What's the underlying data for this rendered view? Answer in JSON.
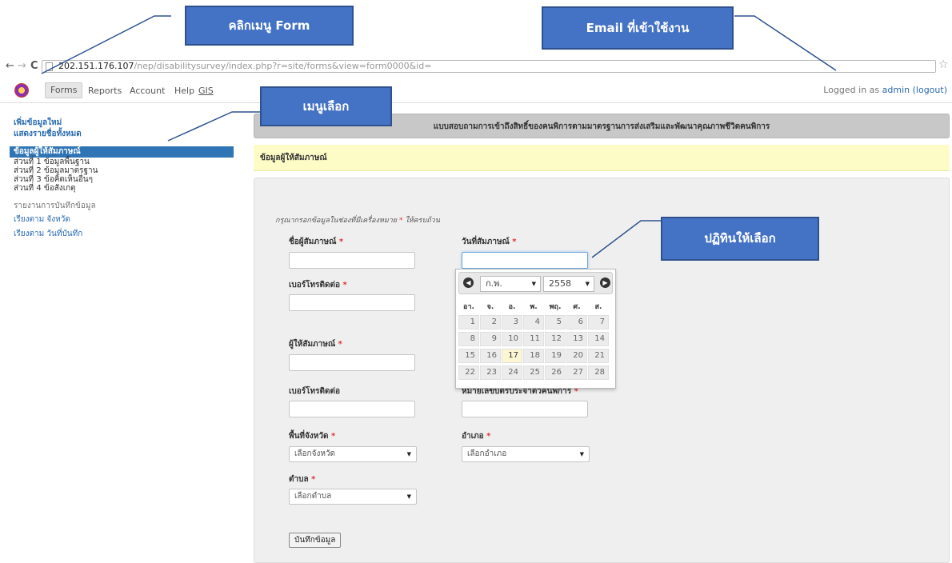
{
  "browser": {
    "back_icon": "←",
    "forward_icon": "→",
    "reload_icon": "C",
    "url_host": "202.151.176.107",
    "url_path": "/nep/disabilitysurvey/index.php?r=site/forms&view=form0000&id=",
    "star_icon": "☆"
  },
  "nav": {
    "items": [
      "Forms",
      "Reports",
      "Account",
      "Help",
      "GIS"
    ],
    "login_prefix": "Logged in as ",
    "login_user": "admin (logout)"
  },
  "sidebar": {
    "add_new": "เพิ่มข้อมูลใหม่",
    "show_all": "แสดงรายชื่อทั้งหมด",
    "active": "ข้อมูลผู้ให้สัมภาษณ์",
    "sections": [
      "ส่วนที่ 1 ข้อมูลพื้นฐาน",
      "ส่วนที่ 2 ข้อมูลมาตรฐาน",
      "ส่วนที่ 3 ข้อคิดเห็นอื่นๆ",
      "ส่วนที่ 4 ข้อสังเกตุ"
    ],
    "report_heading": "รายงานการบันทึกข้อมูล",
    "report_links": [
      "เรียงตาม จังหวัด",
      "เรียงตาม วันที่บันทึก"
    ]
  },
  "main": {
    "title": "แบบสอบถามการเข้าถึงสิทธิ์ของคนพิการตามมาตรฐานการส่งเสริมและพัฒนาคุณภาพชีวิตคนพิการ",
    "section": "ข้อมูลผู้ให้สัมภาษณ์",
    "instruction": "กรุณากรอกข้อมูลในช่องที่มีเครื่องหมาย",
    "instruction_req": " * ",
    "instruction_tail": "ให้ครบถ้วน",
    "required_mark": " *",
    "labels": {
      "interviewer": "ชื่อผู้สัมภาษณ์",
      "interview_date": "วันที่สัมภาษณ์",
      "phone1": "เบอร์โทรติดต่อ",
      "interviewee": "ผู้ให้สัมภาษณ์",
      "phone2": "เบอร์โทรติดต่อ",
      "disability_id": "หมายเลขบัตรประจำตัวคนพิการ",
      "province": "พื้นที่จังหวัด",
      "district": "อำเภอ",
      "subdistrict": "ตำบล"
    },
    "selects": {
      "province": "เลือกจังหวัด",
      "district": "เลือกอำเภอ",
      "subdistrict": "เลือกตำบล"
    },
    "save_button": "บันทึกข้อมูล"
  },
  "datepicker": {
    "month": "ก.พ.",
    "year": "2558",
    "weekdays": [
      "อา.",
      "จ.",
      "อ.",
      "พ.",
      "พฤ.",
      "ศ.",
      "ส."
    ],
    "weeks": [
      [
        "1",
        "2",
        "3",
        "4",
        "5",
        "6",
        "7"
      ],
      [
        "8",
        "9",
        "10",
        "11",
        "12",
        "13",
        "14"
      ],
      [
        "15",
        "16",
        "17",
        "18",
        "19",
        "20",
        "21"
      ],
      [
        "22",
        "23",
        "24",
        "25",
        "26",
        "27",
        "28"
      ]
    ],
    "today": "17"
  },
  "callouts": {
    "form_menu": "คลิกเมนู Form",
    "email": "Email ที่เข้าใช้งาน",
    "menu_select": "เมนูเลือก",
    "calendar": "ปฏิทินให้เลือก"
  },
  "colors": {
    "callout": "#4472c4",
    "sidebar_active": "#2f74b5",
    "section_header": "#fdfcc7"
  }
}
